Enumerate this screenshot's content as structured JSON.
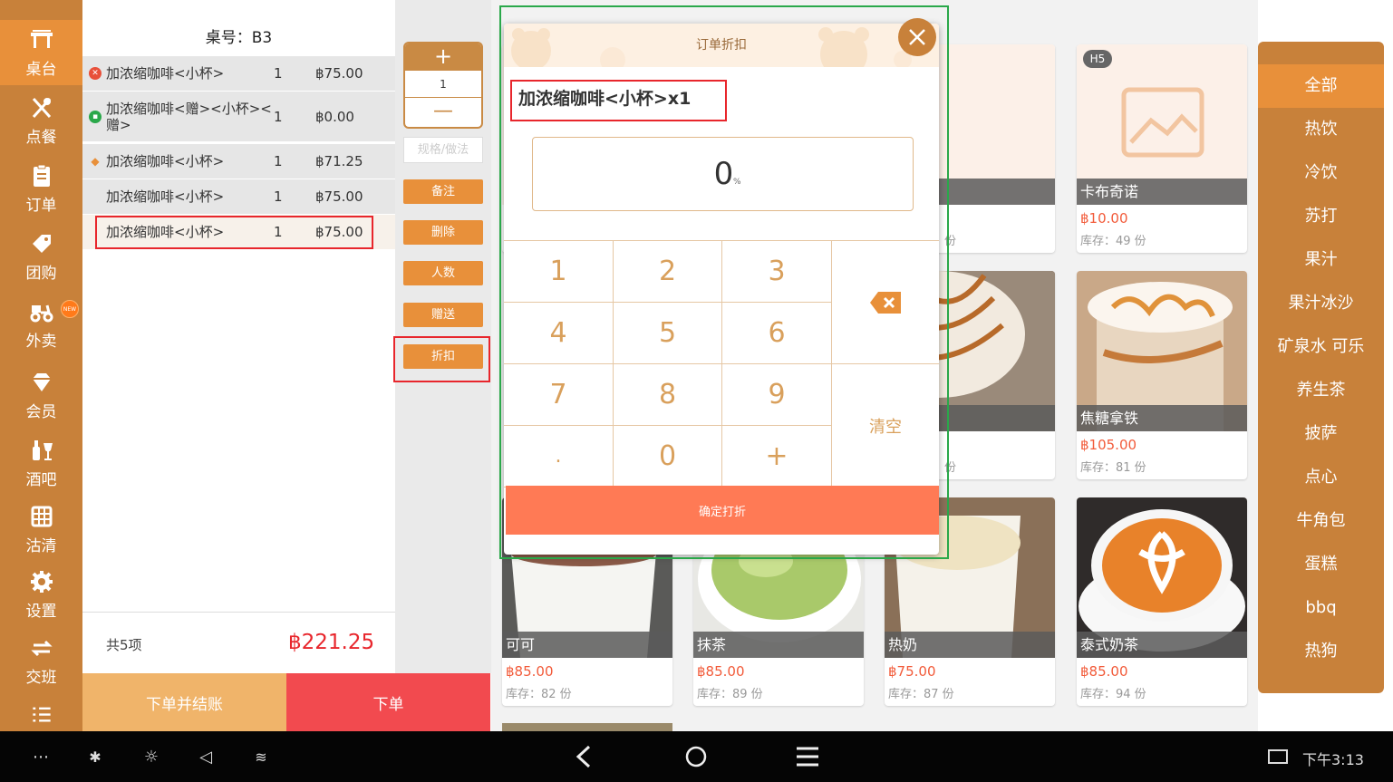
{
  "sidebar": {
    "items": [
      {
        "label": "桌台",
        "icon": "table-icon"
      },
      {
        "label": "点餐",
        "icon": "utensils-icon"
      },
      {
        "label": "订单",
        "icon": "clipboard-icon"
      },
      {
        "label": "团购",
        "icon": "tag-icon"
      },
      {
        "label": "外卖",
        "icon": "scooter-icon"
      },
      {
        "label": "会员",
        "icon": "diamond-icon"
      },
      {
        "label": "酒吧",
        "icon": "wine-icon"
      },
      {
        "label": "沽清",
        "icon": "grid-icon"
      },
      {
        "label": "设置",
        "icon": "gear-icon"
      },
      {
        "label": "交班",
        "icon": "swap-icon"
      }
    ],
    "new_badge": "NEW",
    "accent": "#c8813a"
  },
  "order": {
    "table": "桌号：B3",
    "rows": [
      {
        "name": "加浓缩咖啡<小杯>",
        "qty": "1",
        "price": "฿75.00",
        "mark": "discount",
        "mark_color": "#e8503a"
      },
      {
        "name": "加浓缩咖啡<赠><小杯><赠>",
        "qty": "1",
        "price": "฿0.00",
        "mark": "gift",
        "mark_color": "#2aa84a"
      },
      {
        "name": "加浓缩咖啡<小杯>",
        "qty": "1",
        "price": "฿71.25",
        "mark": "tag",
        "mark_color": "#e8903a"
      },
      {
        "name": "加浓缩咖啡<小杯>",
        "qty": "1",
        "price": "฿75.00",
        "mark": ""
      },
      {
        "name": "加浓缩咖啡<小杯>",
        "qty": "1",
        "price": "฿75.00",
        "mark": ""
      }
    ],
    "count": "共5项",
    "total": "฿221.25",
    "checkout_label": "下单并结账",
    "submit_label": "下单"
  },
  "actions": {
    "plus": "+",
    "qty": "1",
    "minus": "—",
    "spec": "规格/做法",
    "buttons": [
      "备注",
      "删除",
      "人数",
      "赠送",
      "折扣"
    ]
  },
  "products": [
    {
      "name": "卡布奇诺",
      "price": "฿10.00",
      "stock": "库存：49 份",
      "tag": "H5",
      "image": "placeholder"
    },
    {
      "name": "焦糖拿铁",
      "price": "฿105.00",
      "stock": "库存：81 份",
      "image": "caramel-latte"
    },
    {
      "name": "可可",
      "price": "฿85.00",
      "stock": "库存：82 份",
      "image": "cocoa"
    },
    {
      "name": "抹茶",
      "price": "฿85.00",
      "stock": "库存：89 份",
      "image": "matcha"
    },
    {
      "name": "热奶",
      "price": "฿75.00",
      "stock": "库存：87 份",
      "image": "hot-milk"
    },
    {
      "name": "泰式奶茶",
      "price": "฿85.00",
      "stock": "库存：94 份",
      "image": "thai-tea"
    }
  ],
  "partial_products": [
    {
      "stock_unit": "份"
    },
    {
      "stock_unit": "份"
    }
  ],
  "categories": [
    "全部",
    "热饮",
    "冷饮",
    "苏打",
    "果汁",
    "果汁冰沙",
    "矿泉水 可乐",
    "养生茶",
    "披萨",
    "点心",
    "牛角包",
    "蛋糕",
    "bbq",
    "热狗"
  ],
  "modal": {
    "title": "订单折扣",
    "item": "加浓缩咖啡<小杯>x1",
    "value": "0",
    "unit": "%",
    "keys": [
      "1",
      "2",
      "3",
      "4",
      "5",
      "6",
      "7",
      "8",
      "9",
      ".",
      "0",
      "+"
    ],
    "clear": "清空",
    "confirm": "确定打折",
    "confirm_color": "#ff7a55"
  },
  "statusbar": {
    "time": "下午3:13"
  }
}
